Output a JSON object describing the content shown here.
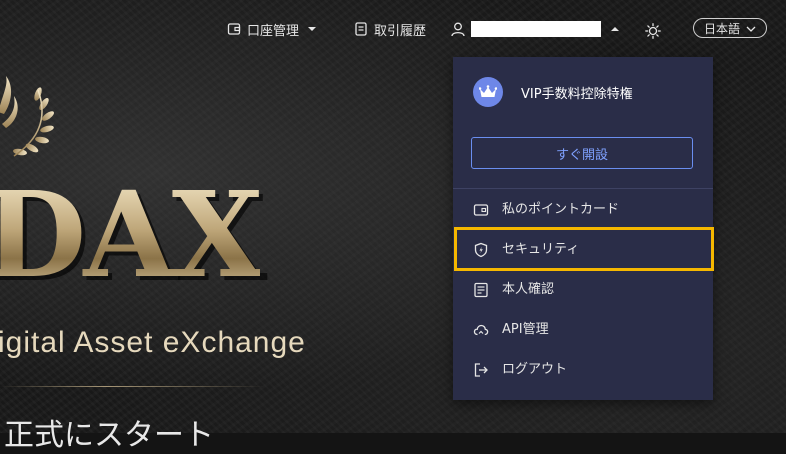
{
  "nav": {
    "account_mgmt_label": "口座管理",
    "trade_history_label": "取引履歴",
    "language_label": "日本語"
  },
  "hero": {
    "logo_text": "DAX",
    "tagline": "igital Asset eXchange",
    "start_text": "正式にスタート"
  },
  "dropdown": {
    "vip_label": "VIP手数料控除特権",
    "open_button_label": "すぐ開設",
    "items": [
      {
        "label": "私のポイントカード",
        "icon": "card-icon"
      },
      {
        "label": "セキュリティ",
        "icon": "shield-icon"
      },
      {
        "label": "本人確認",
        "icon": "id-card-icon"
      },
      {
        "label": "API管理",
        "icon": "api-cloud-icon"
      },
      {
        "label": "ログアウト",
        "icon": "logout-icon"
      }
    ]
  },
  "colors": {
    "dropdown_bg": "#2a2d48",
    "accent_blue": "#6a8ef0",
    "highlight": "#f5b700",
    "gold": "#c9b48a"
  }
}
